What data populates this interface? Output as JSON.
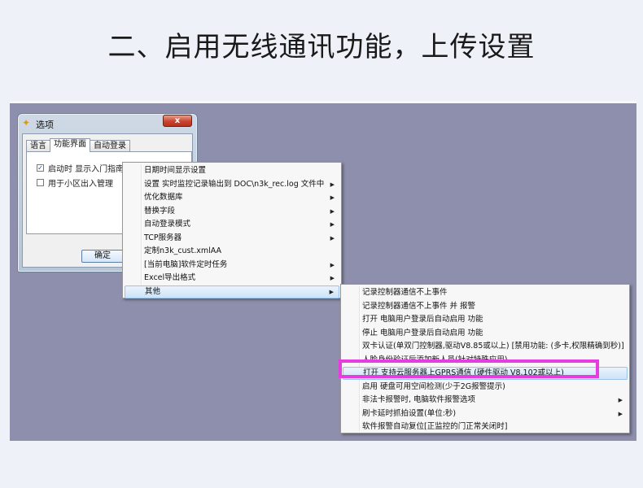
{
  "page": {
    "title": "二、启用无线通讯功能，上传设置"
  },
  "dialog": {
    "title": "选项",
    "close_label": "x",
    "icon": "wizard-star-icon",
    "tabs": [
      "语言",
      "功能界面",
      "自动登录"
    ],
    "checkboxes": [
      {
        "label": "启动时 显示入门指南",
        "checked": true
      },
      {
        "label": "用于小区出入管理",
        "checked": false
      }
    ],
    "ok_label": "确定"
  },
  "menu": {
    "items": [
      {
        "label": "日期时间显示设置",
        "submenu": false
      },
      {
        "label": "设置 实时监控记录输出到 DOC\\n3k_rec.log 文件中",
        "submenu": true
      },
      {
        "label": "优化数据库",
        "submenu": true
      },
      {
        "label": "替换字段",
        "submenu": true
      },
      {
        "label": "自动登录模式",
        "submenu": true
      },
      {
        "label": "TCP服务器",
        "submenu": true
      },
      {
        "label": "定制n3k_cust.xmlAA",
        "submenu": false
      },
      {
        "label": "[当前电脑]软件定时任务",
        "submenu": true
      },
      {
        "label": "Excel导出格式",
        "submenu": true
      },
      {
        "label": "其他",
        "submenu": true,
        "highlighted": true
      }
    ]
  },
  "submenu": {
    "items": [
      {
        "label": "记录控制器通信不上事件",
        "submenu": false
      },
      {
        "label": "记录控制器通信不上事件 并 报警",
        "submenu": false
      },
      {
        "label": "打开 电脑用户登录后自动启用 功能",
        "submenu": false
      },
      {
        "label": "停止 电脑用户登录后自动启用 功能",
        "submenu": false
      },
      {
        "label": "双卡认证(单双门控制器,驱动V8.85或以上) [禁用功能: (多卡,权限精确到秒)]",
        "submenu": false
      },
      {
        "label": "人脸身份验证后添加新人员(针对特殊应用)",
        "submenu": false
      },
      {
        "label": "打开 支持云服务器上GPRS通信 (硬件驱动 V8.102或以上)",
        "submenu": false,
        "highlighted": true
      },
      {
        "label": "启用 硬盘可用空间检测(少于2G报警提示)",
        "submenu": false
      },
      {
        "label": "非法卡报警时, 电脑软件报警选项",
        "submenu": true
      },
      {
        "label": "刷卡延时抓拍设置(单位:秒)",
        "submenu": true
      },
      {
        "label": "软件报警自动复位[正监控的门正常关闭时]",
        "submenu": false
      }
    ]
  },
  "colors": {
    "desktop": "#8e8fad",
    "highlight_frame": "#e63ce0"
  }
}
